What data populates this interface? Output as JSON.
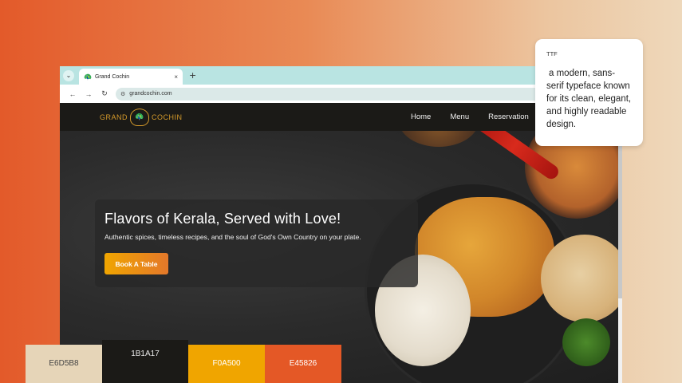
{
  "browser": {
    "tab_title": "Grand Cochin",
    "tab_favicon": "🦚",
    "tab_close": "×",
    "new_tab": "+",
    "menu_icon": "⌄",
    "back": "←",
    "forward": "→",
    "reload": "↻",
    "site_info_icon": "⚙",
    "url": "grandcochin.com"
  },
  "site": {
    "logo_left": "GRAND",
    "logo_right": "COCHIN",
    "logo_emblem": "🦚",
    "nav": [
      "Home",
      "Menu",
      "Reservation"
    ]
  },
  "hero": {
    "title": "Flavors of Kerala, Served with Love!",
    "subtitle": "Authentic spices, timeless recipes, and the soul of God's Own Country on your plate.",
    "cta": "Book A Table"
  },
  "note": {
    "label": "TTF",
    "text": "a modern, sans-serif typeface known for its clean, elegant, and highly readable design."
  },
  "palette": [
    {
      "hex": "E6D5B8",
      "color": "#E6D5B8"
    },
    {
      "hex": "1B1A17",
      "color": "#1B1A17"
    },
    {
      "hex": "F0A500",
      "color": "#F0A500"
    },
    {
      "hex": "E45826",
      "color": "#E45826"
    }
  ]
}
